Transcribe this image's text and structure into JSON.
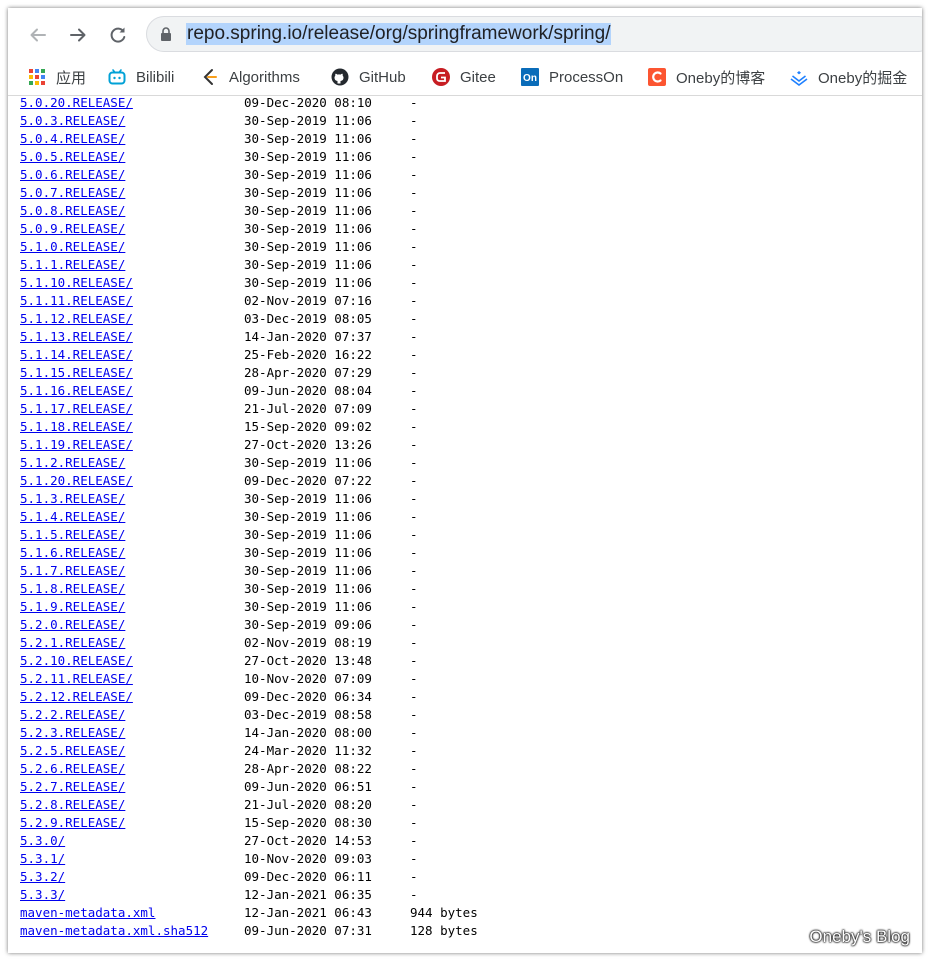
{
  "browser": {
    "url": "repo.spring.io/release/org/springframework/spring/",
    "back_icon": "back-arrow-icon",
    "forward_icon": "forward-arrow-icon",
    "reload_icon": "reload-icon"
  },
  "bookmarks": [
    {
      "label": "应用",
      "icon": "apps-grid-icon"
    },
    {
      "label": "Bilibili",
      "icon": "bilibili-icon"
    },
    {
      "label": "Algorithms",
      "icon": "algorithms-icon"
    },
    {
      "label": "GitHub",
      "icon": "github-icon"
    },
    {
      "label": "Gitee",
      "icon": "gitee-icon"
    },
    {
      "label": "ProcessOn",
      "icon": "processon-icon"
    },
    {
      "label": "Oneby的博客",
      "icon": "csdn-icon"
    },
    {
      "label": "Oneby的掘金",
      "icon": "juejin-icon"
    }
  ],
  "listing": [
    {
      "name": "5.0.20.RELEASE/",
      "date": "09-Dec-2020 08:10",
      "size": "-"
    },
    {
      "name": "5.0.3.RELEASE/",
      "date": "30-Sep-2019 11:06",
      "size": "-"
    },
    {
      "name": "5.0.4.RELEASE/",
      "date": "30-Sep-2019 11:06",
      "size": "-"
    },
    {
      "name": "5.0.5.RELEASE/",
      "date": "30-Sep-2019 11:06",
      "size": "-"
    },
    {
      "name": "5.0.6.RELEASE/",
      "date": "30-Sep-2019 11:06",
      "size": "-"
    },
    {
      "name": "5.0.7.RELEASE/",
      "date": "30-Sep-2019 11:06",
      "size": "-"
    },
    {
      "name": "5.0.8.RELEASE/",
      "date": "30-Sep-2019 11:06",
      "size": "-"
    },
    {
      "name": "5.0.9.RELEASE/",
      "date": "30-Sep-2019 11:06",
      "size": "-"
    },
    {
      "name": "5.1.0.RELEASE/",
      "date": "30-Sep-2019 11:06",
      "size": "-"
    },
    {
      "name": "5.1.1.RELEASE/",
      "date": "30-Sep-2019 11:06",
      "size": "-"
    },
    {
      "name": "5.1.10.RELEASE/",
      "date": "30-Sep-2019 11:06",
      "size": "-"
    },
    {
      "name": "5.1.11.RELEASE/",
      "date": "02-Nov-2019 07:16",
      "size": "-"
    },
    {
      "name": "5.1.12.RELEASE/",
      "date": "03-Dec-2019 08:05",
      "size": "-"
    },
    {
      "name": "5.1.13.RELEASE/",
      "date": "14-Jan-2020 07:37",
      "size": "-"
    },
    {
      "name": "5.1.14.RELEASE/",
      "date": "25-Feb-2020 16:22",
      "size": "-"
    },
    {
      "name": "5.1.15.RELEASE/",
      "date": "28-Apr-2020 07:29",
      "size": "-"
    },
    {
      "name": "5.1.16.RELEASE/",
      "date": "09-Jun-2020 08:04",
      "size": "-"
    },
    {
      "name": "5.1.17.RELEASE/",
      "date": "21-Jul-2020 07:09",
      "size": "-"
    },
    {
      "name": "5.1.18.RELEASE/",
      "date": "15-Sep-2020 09:02",
      "size": "-"
    },
    {
      "name": "5.1.19.RELEASE/",
      "date": "27-Oct-2020 13:26",
      "size": "-"
    },
    {
      "name": "5.1.2.RELEASE/",
      "date": "30-Sep-2019 11:06",
      "size": "-"
    },
    {
      "name": "5.1.20.RELEASE/",
      "date": "09-Dec-2020 07:22",
      "size": "-"
    },
    {
      "name": "5.1.3.RELEASE/",
      "date": "30-Sep-2019 11:06",
      "size": "-"
    },
    {
      "name": "5.1.4.RELEASE/",
      "date": "30-Sep-2019 11:06",
      "size": "-"
    },
    {
      "name": "5.1.5.RELEASE/",
      "date": "30-Sep-2019 11:06",
      "size": "-"
    },
    {
      "name": "5.1.6.RELEASE/",
      "date": "30-Sep-2019 11:06",
      "size": "-"
    },
    {
      "name": "5.1.7.RELEASE/",
      "date": "30-Sep-2019 11:06",
      "size": "-"
    },
    {
      "name": "5.1.8.RELEASE/",
      "date": "30-Sep-2019 11:06",
      "size": "-"
    },
    {
      "name": "5.1.9.RELEASE/",
      "date": "30-Sep-2019 11:06",
      "size": "-"
    },
    {
      "name": "5.2.0.RELEASE/",
      "date": "30-Sep-2019 09:06",
      "size": "-"
    },
    {
      "name": "5.2.1.RELEASE/",
      "date": "02-Nov-2019 08:19",
      "size": "-"
    },
    {
      "name": "5.2.10.RELEASE/",
      "date": "27-Oct-2020 13:48",
      "size": "-"
    },
    {
      "name": "5.2.11.RELEASE/",
      "date": "10-Nov-2020 07:09",
      "size": "-"
    },
    {
      "name": "5.2.12.RELEASE/",
      "date": "09-Dec-2020 06:34",
      "size": "-"
    },
    {
      "name": "5.2.2.RELEASE/",
      "date": "03-Dec-2019 08:58",
      "size": "-"
    },
    {
      "name": "5.2.3.RELEASE/",
      "date": "14-Jan-2020 08:00",
      "size": "-"
    },
    {
      "name": "5.2.5.RELEASE/",
      "date": "24-Mar-2020 11:32",
      "size": "-"
    },
    {
      "name": "5.2.6.RELEASE/",
      "date": "28-Apr-2020 08:22",
      "size": "-"
    },
    {
      "name": "5.2.7.RELEASE/",
      "date": "09-Jun-2020 06:51",
      "size": "-"
    },
    {
      "name": "5.2.8.RELEASE/",
      "date": "21-Jul-2020 08:20",
      "size": "-"
    },
    {
      "name": "5.2.9.RELEASE/",
      "date": "15-Sep-2020 08:30",
      "size": "-"
    },
    {
      "name": "5.3.0/",
      "date": "27-Oct-2020 14:53",
      "size": "-"
    },
    {
      "name": "5.3.1/",
      "date": "10-Nov-2020 09:03",
      "size": "-"
    },
    {
      "name": "5.3.2/",
      "date": "09-Dec-2020 06:11",
      "size": "-"
    },
    {
      "name": "5.3.3/",
      "date": "12-Jan-2021 06:35",
      "size": "-"
    },
    {
      "name": "maven-metadata.xml",
      "date": "12-Jan-2021 06:43",
      "size": "944 bytes"
    },
    {
      "name": "maven-metadata.xml.sha512",
      "date": "09-Jun-2020 07:31",
      "size": "128 bytes"
    }
  ],
  "watermark": "Oneby's Blog",
  "colors": {
    "link": "#0000ee",
    "url_highlight": "#b3d4fc",
    "csdn": "#fc5531",
    "gitee": "#c71d23",
    "bilibili": "#00a1d6",
    "processon": "#0a6cb9",
    "juejin": "#1e80ff"
  }
}
